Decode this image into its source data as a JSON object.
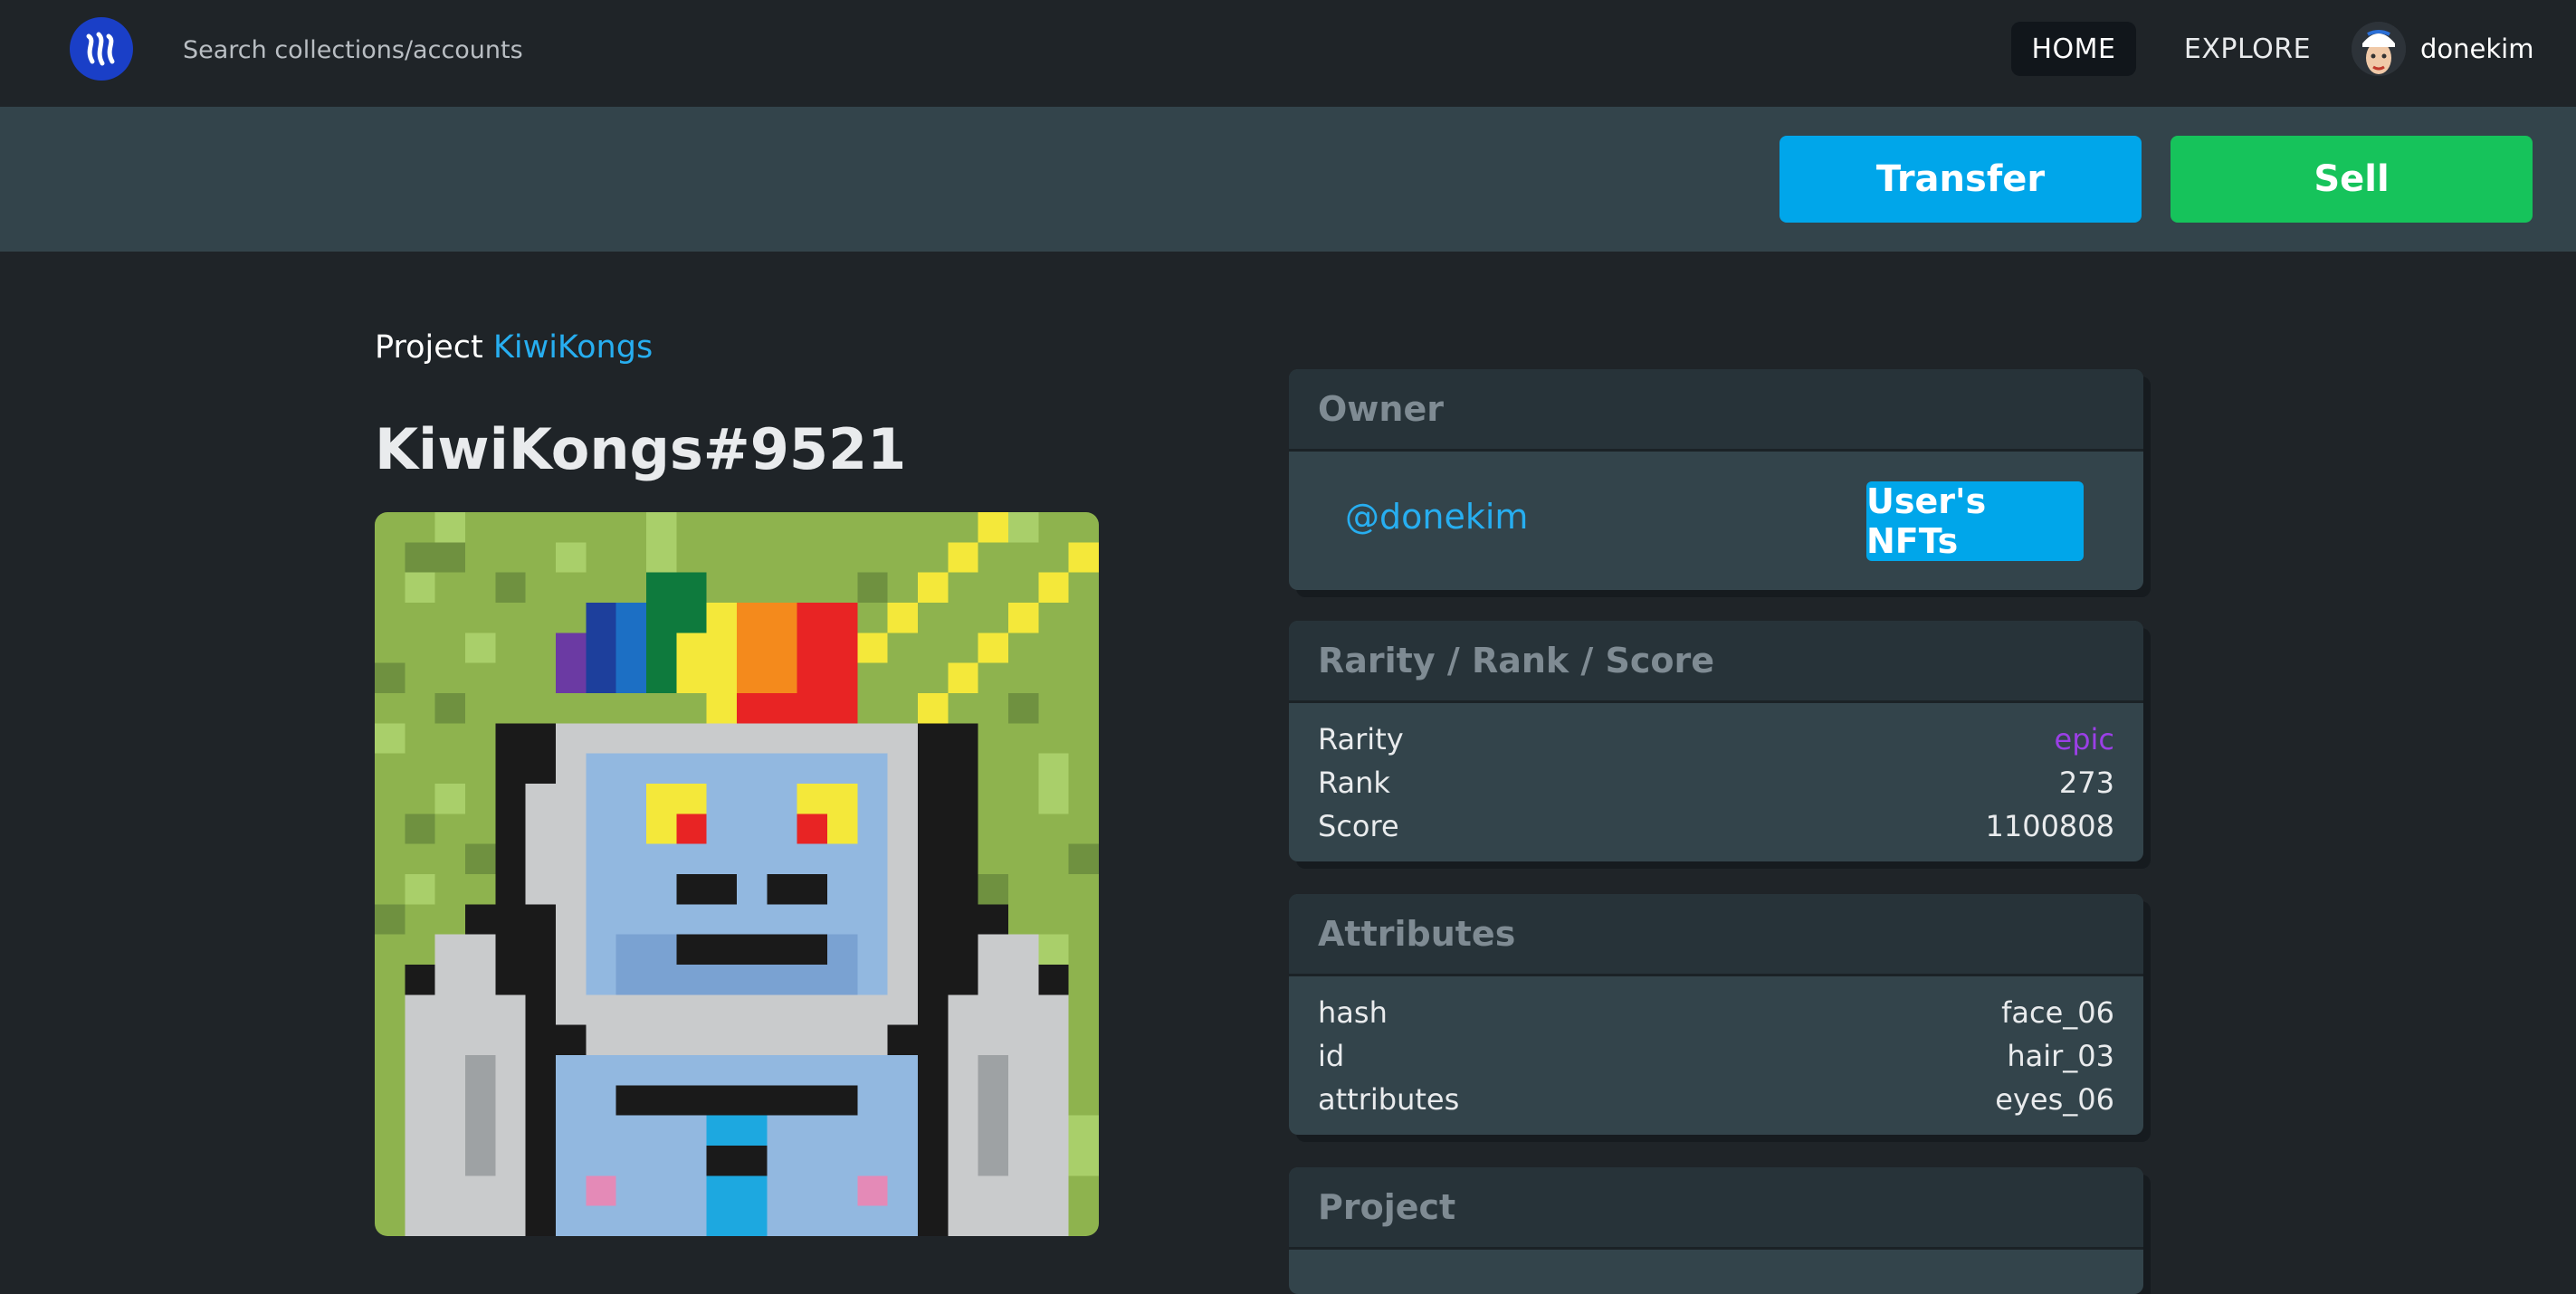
{
  "nav": {
    "search_placeholder": "Search collections/accounts",
    "home_label": "HOME",
    "explore_label": "EXPLORE",
    "username": "donekim"
  },
  "actions": {
    "transfer_label": "Transfer",
    "sell_label": "Sell"
  },
  "nft": {
    "project_prefix": "Project",
    "project_name": "KiwiKongs",
    "title": "KiwiKongs#9521"
  },
  "owner": {
    "header": "Owner",
    "handle": "@donekim",
    "users_nfts_label": "User's NFTs"
  },
  "rarity": {
    "header": "Rarity / Rank / Score",
    "rows": [
      {
        "label": "Rarity",
        "value": "epic"
      },
      {
        "label": "Rank",
        "value": "273"
      },
      {
        "label": "Score",
        "value": "1100808"
      }
    ]
  },
  "attributes": {
    "header": "Attributes",
    "rows": [
      {
        "label": "hash",
        "value": "face_06"
      },
      {
        "label": "id",
        "value": "hair_03"
      },
      {
        "label": "attributes",
        "value": "eyes_06"
      }
    ]
  },
  "project_panel": {
    "header": "Project"
  },
  "colors": {
    "accent_blue": "#00a6ea",
    "sell_green": "#16c35b",
    "link_blue": "#27aef0",
    "epic_purple": "#9b3fe6"
  },
  "icons": {
    "logo": "steem-logo-icon",
    "avatar": "user-avatar"
  }
}
